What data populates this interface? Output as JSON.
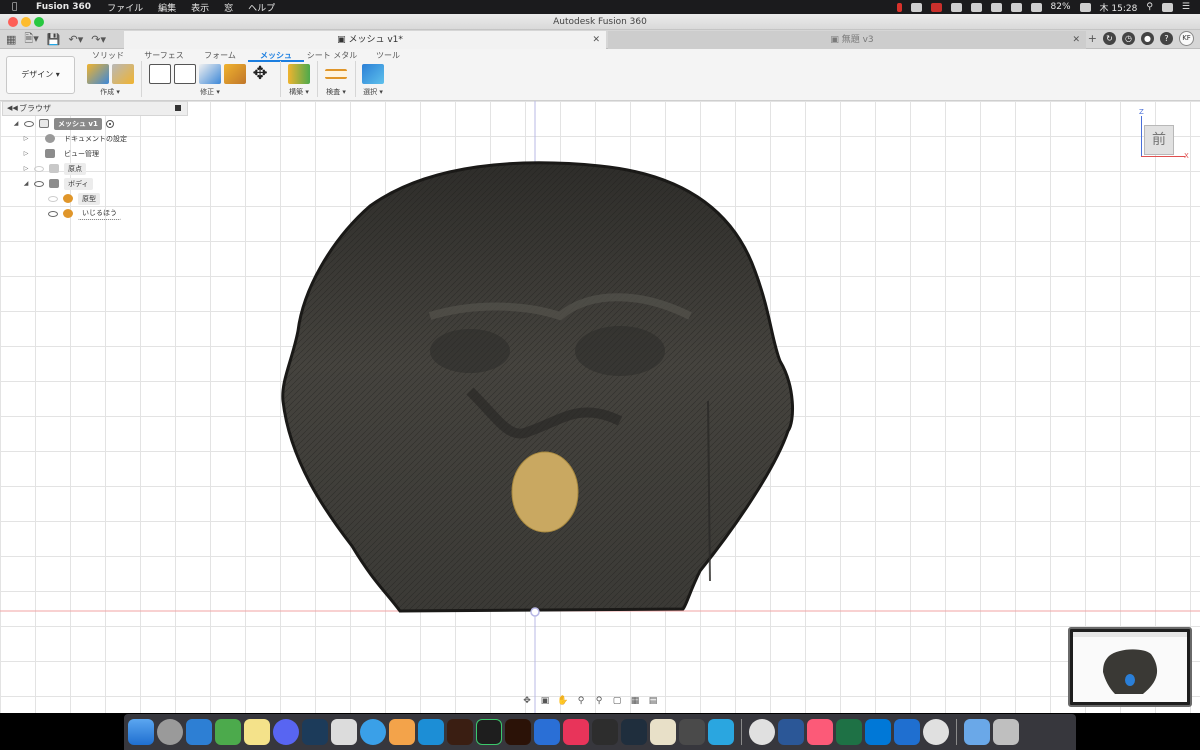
{
  "menubar": {
    "app_name": "Fusion 360",
    "items": [
      "ファイル",
      "編集",
      "表示",
      "窓",
      "ヘルプ"
    ],
    "battery": "82%",
    "clock": "木 15:28"
  },
  "window": {
    "title": "Autodesk Fusion 360"
  },
  "tabs": {
    "active": {
      "label": "メッシュ v1*"
    },
    "inactive": {
      "label": "無題 v3"
    }
  },
  "account": {
    "initials": "KF"
  },
  "toolbar": {
    "workspace_button": "デザイン",
    "workspace_tabs": [
      "ソリッド",
      "サーフェス",
      "フォーム",
      "メッシュ",
      "シート メタル",
      "ツール"
    ],
    "active_tab_index": 3,
    "groups": {
      "create": "作成",
      "modify": "修正",
      "construct": "構築",
      "inspect": "検査",
      "select": "選択"
    }
  },
  "browser": {
    "title": "ブラウザ",
    "tree": {
      "root": "メッシュ v1",
      "doc_settings": "ドキュメントの設定",
      "view_mgmt": "ビュー管理",
      "origin": "原点",
      "bodies": "ボディ",
      "body1": "原型",
      "body2": "いじるほう"
    }
  },
  "viewcube": {
    "face": "前",
    "axis_z": "Z",
    "axis_x": "X"
  },
  "colors": {
    "accent": "#1b7ee0",
    "mesh_body": "#3a3935",
    "selected_face": "#c9a861",
    "ground_line": "#f2a3a3"
  }
}
